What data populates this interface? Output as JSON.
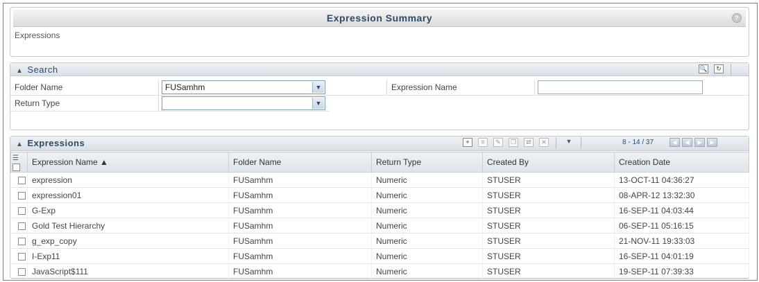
{
  "summary": {
    "title": "Expression Summary",
    "subtitle": "Expressions",
    "help_glyph": "?"
  },
  "search": {
    "title": "Search",
    "collapse_glyph": "»",
    "fields": {
      "folder_label": "Folder Name",
      "folder_value": "FUSamhm",
      "expression_name_label": "Expression Name",
      "expression_name_value": "",
      "return_type_label": "Return Type",
      "return_type_value": ""
    },
    "icons": [
      "search-icon",
      "reset-icon"
    ]
  },
  "grid": {
    "title": "Expressions",
    "toolbar_icons": [
      "add-icon",
      "view-icon",
      "edit-icon",
      "copy-icon",
      "move-icon",
      "delete-icon",
      "filter-icon"
    ],
    "pager_text": "8 - 14 / 37",
    "columns": [
      "Expression Name ▲",
      "Folder Name",
      "Return Type",
      "Created By",
      "Creation Date"
    ],
    "rows": [
      {
        "name": "expression",
        "folder": "FUSamhm",
        "return_type": "Numeric",
        "created_by": "STUSER",
        "date": "13-OCT-11 04:36:27"
      },
      {
        "name": "expression01",
        "folder": "FUSamhm",
        "return_type": "Numeric",
        "created_by": "STUSER",
        "date": "08-APR-12 13:32:30"
      },
      {
        "name": "G-Exp",
        "folder": "FUSamhm",
        "return_type": "Numeric",
        "created_by": "STUSER",
        "date": "16-SEP-11 04:03:44"
      },
      {
        "name": "Gold Test Hierarchy",
        "folder": "FUSamhm",
        "return_type": "Numeric",
        "created_by": "STUSER",
        "date": "06-SEP-11 05:16:15"
      },
      {
        "name": "g_exp_copy",
        "folder": "FUSamhm",
        "return_type": "Numeric",
        "created_by": "STUSER",
        "date": "21-NOV-11 19:33:03"
      },
      {
        "name": "I-Exp11",
        "folder": "FUSamhm",
        "return_type": "Numeric",
        "created_by": "STUSER",
        "date": "16-SEP-11 04:01:19"
      },
      {
        "name": "JavaScript$111",
        "folder": "FUSamhm",
        "return_type": "Numeric",
        "created_by": "STUSER",
        "date": "19-SEP-11 07:39:33"
      }
    ]
  },
  "colors": {
    "header_text": "#2d4a66",
    "link_blue": "#27497a"
  }
}
